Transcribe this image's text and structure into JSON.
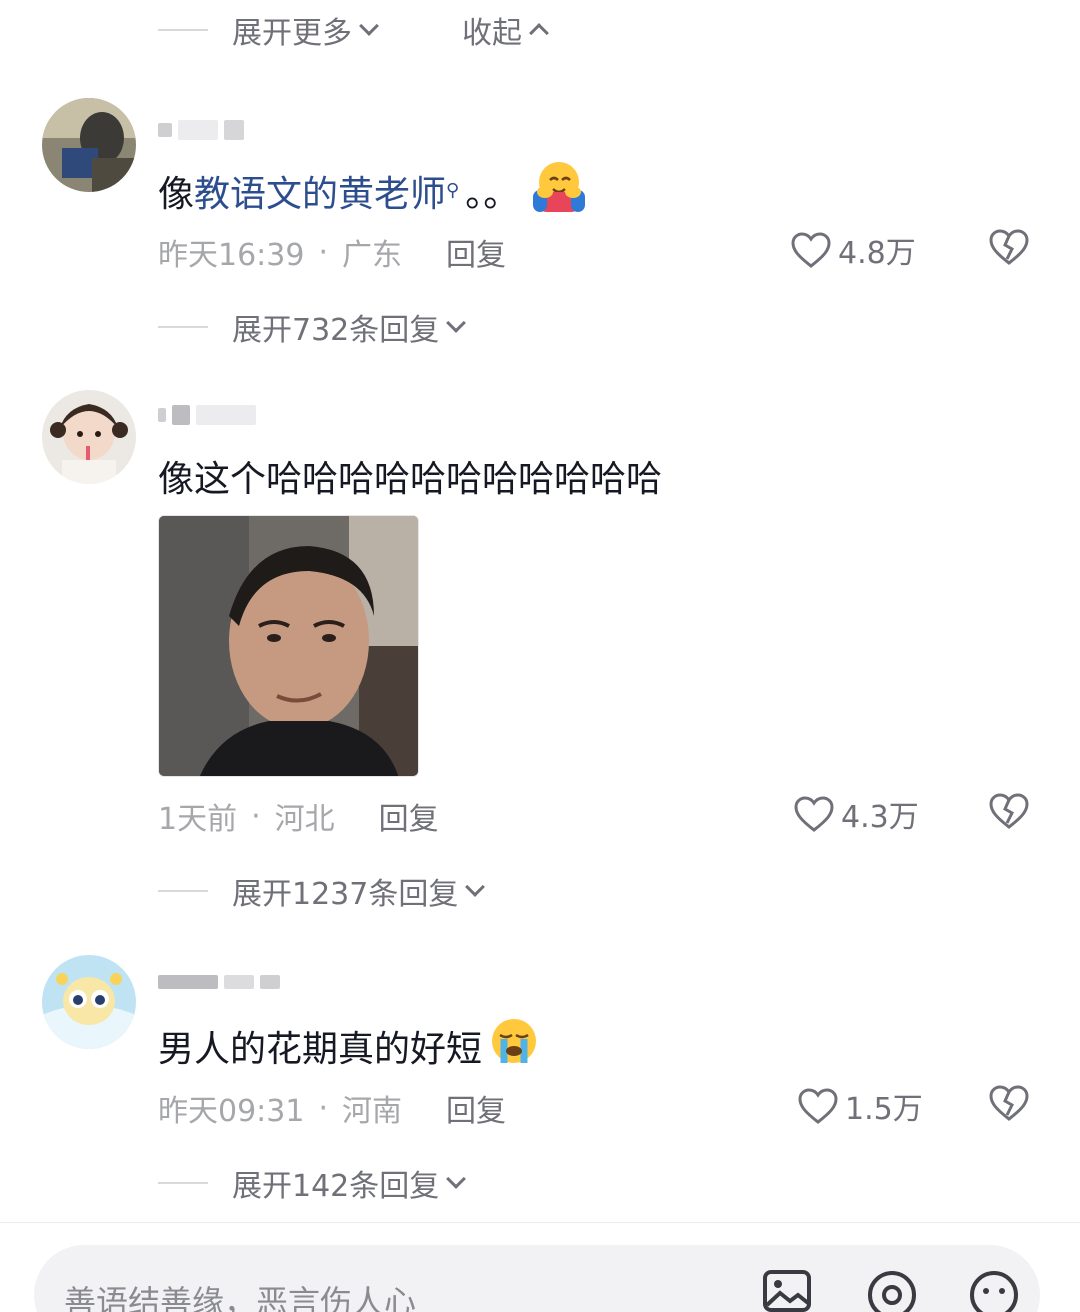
{
  "top_bar": {
    "expand_more": "展开更多",
    "collapse": "收起"
  },
  "comments": [
    {
      "text_plain": "像",
      "text_link": "教语文的黄老师",
      "text_tail": "。。",
      "emoji": "hugging-face-emoji",
      "time": "昨天16:39",
      "location": "广东",
      "reply": "回复",
      "likes": "4.8万",
      "expand_replies": "展开732条回复"
    },
    {
      "text": "像这个哈哈哈哈哈哈哈哈哈哈哈",
      "time": "1天前",
      "location": "河北",
      "reply": "回复",
      "likes": "4.3万",
      "expand_replies": "展开1237条回复"
    },
    {
      "text": "男人的花期真的好短",
      "emoji": "loudly-crying-face-emoji",
      "time": "昨天09:31",
      "location": "河南",
      "reply": "回复",
      "likes": "1.5万",
      "expand_replies": "展开142条回复"
    }
  ],
  "input": {
    "placeholder": "善语结善缘，恶言伤人心"
  },
  "separator": "·",
  "colors": {
    "link": "#2d4e8e",
    "secondary_text": "#a6a7ab",
    "primary_text": "#161823"
  }
}
